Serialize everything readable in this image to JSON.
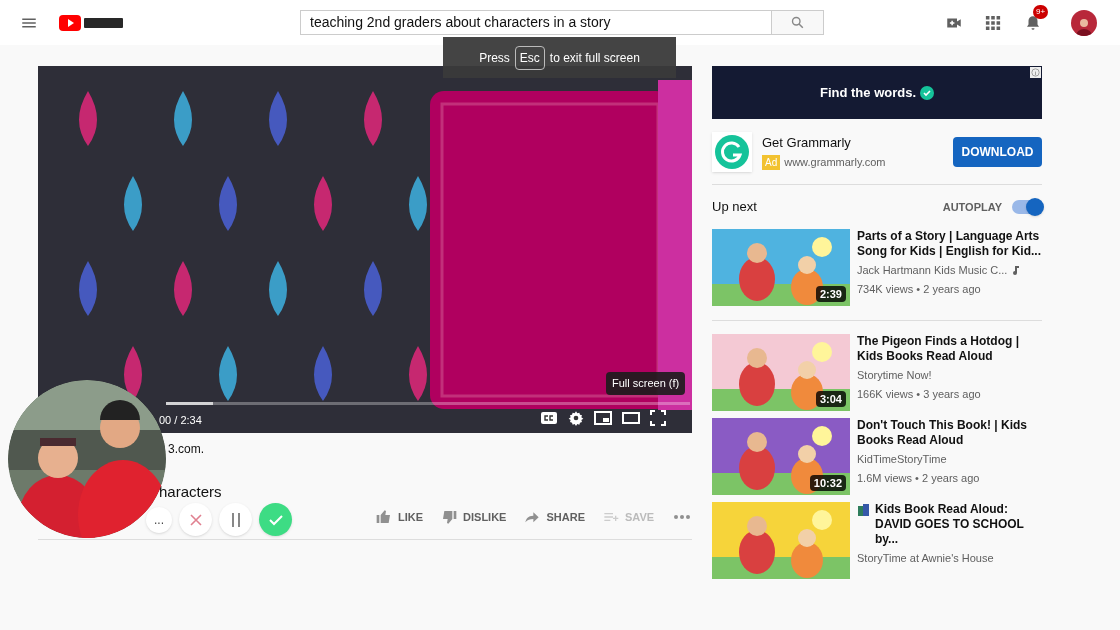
{
  "header": {
    "search": {
      "value": "teaching 2nd graders about characters in a story"
    },
    "notification_badge": "9+"
  },
  "fullscreen_banner": {
    "before": "Press",
    "key": "Esc",
    "after": "to exit full screen"
  },
  "player": {
    "time": "00 / 2:34",
    "progress": {
      "level": 0.09
    },
    "tooltip": "Full screen (f)"
  },
  "below_video": {
    "description_fragment": "3.com.",
    "title_fragment": "haracters",
    "actions": [
      {
        "label": "LIKE",
        "kind": "like",
        "disabled": false
      },
      {
        "label": "DISLIKE",
        "kind": "dislike",
        "disabled": false
      },
      {
        "label": "SHARE",
        "kind": "share",
        "disabled": false
      },
      {
        "label": "SAVE",
        "kind": "save",
        "disabled": true
      }
    ]
  },
  "recorder": {
    "buttons": [
      {
        "kind": "more",
        "label": "..."
      },
      {
        "kind": "cancel"
      },
      {
        "kind": "pause"
      },
      {
        "kind": "done"
      }
    ]
  },
  "ad": {
    "banner_text": "Find the words.",
    "title": "Get Grammarly",
    "badge": "Ad",
    "url": "www.grammarly.com",
    "button": "DOWNLOAD"
  },
  "up_next": {
    "heading": "Up next",
    "autoplay_label": "AUTOPLAY",
    "autoplay_on": true
  },
  "videos": [
    {
      "title": "Parts of a Story | Language Arts Song for Kids | English for Kid...",
      "channel": "Jack Hartmann Kids Music C...",
      "music_channel": true,
      "meta": "734K views • 2 years ago",
      "duration": "2:39",
      "book_icon": false
    },
    {
      "title": "The Pigeon Finds a Hotdog | Kids Books Read Aloud",
      "channel": "Storytime Now!",
      "music_channel": false,
      "meta": "166K views • 3 years ago",
      "duration": "3:04",
      "book_icon": false
    },
    {
      "title": "Don't Touch This Book! | Kids Books Read Aloud",
      "channel": "KidTimeStoryTime",
      "music_channel": false,
      "meta": "1.6M views • 2 years ago",
      "duration": "10:32",
      "book_icon": false
    },
    {
      "title": "Kids Book Read Aloud: DAVID GOES TO SCHOOL by...",
      "channel": "StoryTime at Awnie's House",
      "music_channel": false,
      "book_icon": true
    }
  ]
}
